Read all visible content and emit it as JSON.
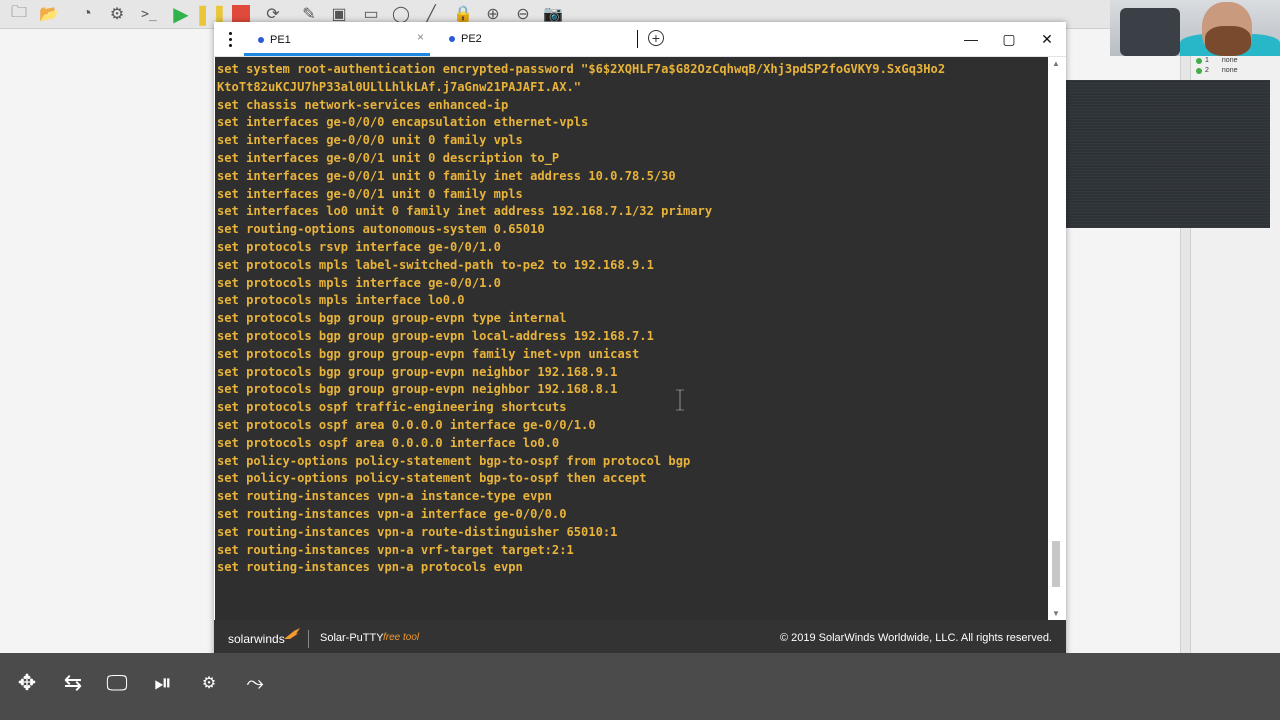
{
  "host": {
    "toolbar_icons": [
      "new-project-icon",
      "open-folder-icon",
      "timer-icon",
      "settings-icon",
      "console-icon",
      "start-all-icon",
      "suspend-all-icon",
      "stop-all-icon",
      "reload-icon",
      "edit-icon",
      "screenshot-icon",
      "rectangle-icon",
      "ellipse-icon",
      "line-icon",
      "lock-icon",
      "zoom-in-icon",
      "zoom-out-icon",
      "camera-icon"
    ],
    "legend": [
      {
        "num": "1",
        "label": "none"
      },
      {
        "num": "2",
        "label": "none"
      }
    ],
    "bottom_icons": [
      "router-icon",
      "switch-icon",
      "end-device-icon",
      "security-device-icon",
      "all-devices-icon",
      "link-icon"
    ]
  },
  "putty": {
    "tabs": [
      {
        "label": "PE1",
        "active": true
      },
      {
        "label": "PE2",
        "active": false
      }
    ],
    "tab_close": "×",
    "add_tab": "+",
    "window": {
      "minimize": "—",
      "maximize": "▢",
      "close": "✕"
    },
    "terminal_lines": [
      "set system root-authentication encrypted-password \"$6$2XQHLF7a$G82OzCqhwqB/Xhj3pdSP2foGVKY9.SxGq3Ho2",
      "KtoTt82uKCJU7hP33al0ULlLhlkLAf.j7aGnw21PAJAFI.AX.\"",
      "set chassis network-services enhanced-ip",
      "set interfaces ge-0/0/0 encapsulation ethernet-vpls",
      "set interfaces ge-0/0/0 unit 0 family vpls",
      "set interfaces ge-0/0/1 unit 0 description to_P",
      "set interfaces ge-0/0/1 unit 0 family inet address 10.0.78.5/30",
      "set interfaces ge-0/0/1 unit 0 family mpls",
      "set interfaces lo0 unit 0 family inet address 192.168.7.1/32 primary",
      "set routing-options autonomous-system 0.65010",
      "set protocols rsvp interface ge-0/0/1.0",
      "set protocols mpls label-switched-path to-pe2 to 192.168.9.1",
      "set protocols mpls interface ge-0/0/1.0",
      "set protocols mpls interface lo0.0",
      "set protocols bgp group group-evpn type internal",
      "set protocols bgp group group-evpn local-address 192.168.7.1",
      "set protocols bgp group group-evpn family inet-vpn unicast",
      "set protocols bgp group group-evpn neighbor 192.168.9.1",
      "set protocols bgp group group-evpn neighbor 192.168.8.1",
      "set protocols ospf traffic-engineering shortcuts",
      "set protocols ospf area 0.0.0.0 interface ge-0/0/1.0",
      "set protocols ospf area 0.0.0.0 interface lo0.0",
      "set policy-options policy-statement bgp-to-ospf from protocol bgp",
      "set policy-options policy-statement bgp-to-ospf then accept",
      "set routing-instances vpn-a instance-type evpn",
      "set routing-instances vpn-a interface ge-0/0/0.0",
      "set routing-instances vpn-a route-distinguisher 65010:1",
      "set routing-instances vpn-a vrf-target target:2:1",
      "set routing-instances vpn-a protocols evpn"
    ],
    "footer": {
      "brand": "solarwinds",
      "product": "Solar-PuTTY",
      "free_tool": "free tool",
      "copyright": "© 2019 SolarWinds Worldwide, LLC. All rights reserved."
    },
    "colors": {
      "terminal_bg": "#2f2f2f",
      "terminal_text": "#e8b33a",
      "tab_accent": "#1e88e5",
      "footer_bg": "#333333",
      "brand_orange": "#f29a2e"
    }
  }
}
